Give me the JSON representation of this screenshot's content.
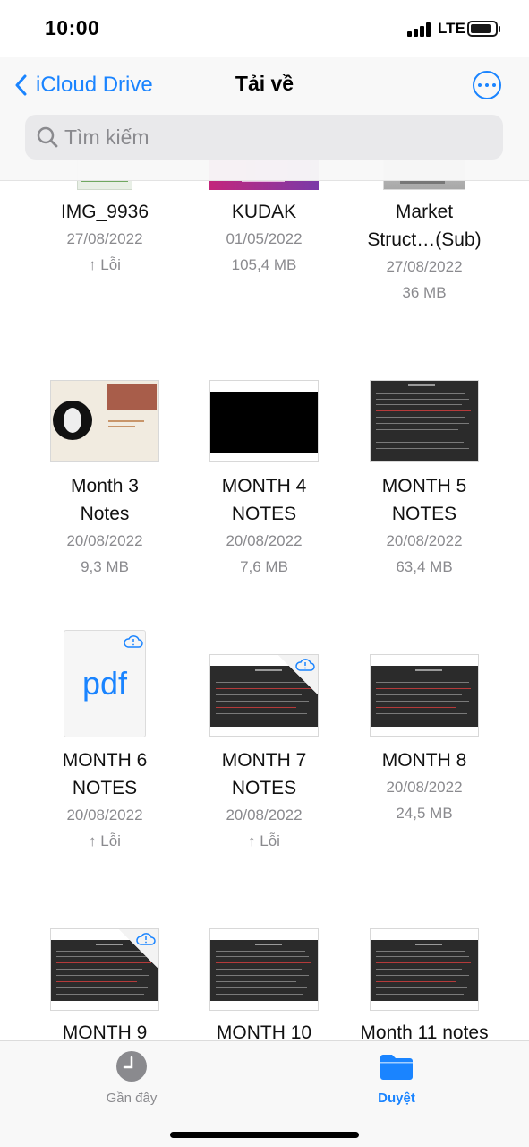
{
  "status_bar": {
    "time": "10:00",
    "network": "LTE",
    "battery_level": 0.85
  },
  "nav": {
    "back_label": "iCloud Drive",
    "title": "Tải về"
  },
  "search": {
    "placeholder": "Tìm kiếm"
  },
  "files": [
    {
      "name": "IMG_9936",
      "date": "27/08/2022",
      "status": "↑ Lỗi"
    },
    {
      "name": "KUDAK",
      "date": "01/05/2022",
      "size": "105,4 MB"
    },
    {
      "name": "Market Struct…(Sub)",
      "date": "27/08/2022",
      "size": "36 MB"
    },
    {
      "name": "Month 3 Notes",
      "date": "20/08/2022",
      "size": "9,3 MB"
    },
    {
      "name": "MONTH 4 NOTES",
      "date": "20/08/2022",
      "size": "7,6 MB"
    },
    {
      "name": "MONTH 5 NOTES",
      "date": "20/08/2022",
      "size": "63,4 MB"
    },
    {
      "name": "MONTH 6 NOTES",
      "date": "20/08/2022",
      "status": "↑ Lỗi",
      "icon_label": "pdf"
    },
    {
      "name": "MONTH 7 NOTES",
      "date": "20/08/2022",
      "status": "↑ Lỗi"
    },
    {
      "name": "MONTH 8",
      "date": "20/08/2022",
      "size": "24,5 MB"
    },
    {
      "name": "MONTH 9"
    },
    {
      "name": "MONTH 10"
    },
    {
      "name": "Month 11 notes"
    }
  ],
  "tabbar": {
    "recents_label": "Gần đây",
    "browse_label": "Duyệt",
    "accent": "#1a84ff",
    "inactive": "#8a8a8e"
  }
}
